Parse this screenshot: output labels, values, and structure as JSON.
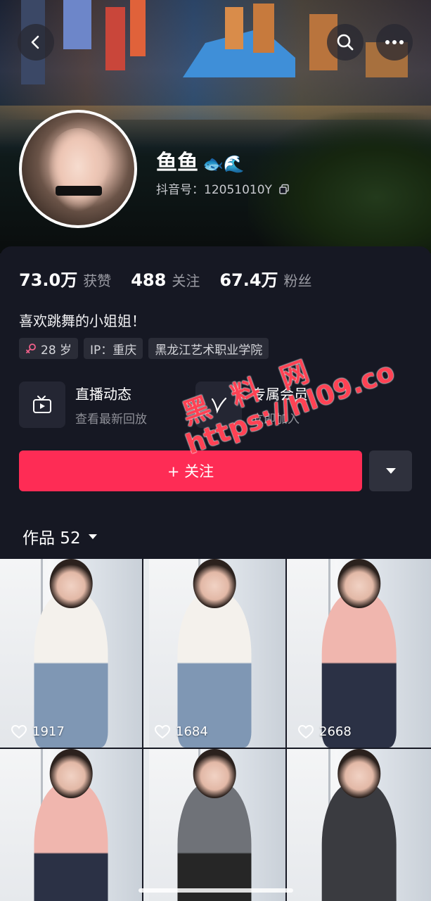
{
  "header": {
    "back_icon": "chevron-left-icon",
    "search_icon": "search-icon",
    "more_icon": "ellipsis-icon"
  },
  "profile": {
    "name": "鱼鱼",
    "name_emojis": "🐟🌊",
    "douyin_id": "抖音号：12051010Y",
    "copy_icon": "copy-icon"
  },
  "stats": [
    {
      "value": "73.0万",
      "label": "获赞"
    },
    {
      "value": "488",
      "label": "关注"
    },
    {
      "value": "67.4万",
      "label": "粉丝"
    }
  ],
  "bio": "喜欢跳舞的小姐姐！",
  "tags": [
    {
      "icon": "female-icon",
      "text": "28 岁"
    },
    {
      "text": "IP：重庆"
    },
    {
      "text": "黑龙江艺术职业学院"
    }
  ],
  "features": [
    {
      "icon": "tv-icon",
      "title": "直播动态",
      "subtitle": "查看最新回放"
    },
    {
      "icon": "heart-v-icon",
      "title": "专属会员",
      "subtitle": "立即加入"
    }
  ],
  "actions": {
    "follow_label": "+ 关注",
    "dropdown_icon": "caret-down-icon"
  },
  "works": {
    "label": "作品 52"
  },
  "videos": [
    {
      "likes": "1917",
      "top": "white",
      "bottom": "denim"
    },
    {
      "likes": "1684",
      "top": "white",
      "bottom": "denim"
    },
    {
      "likes": "2668",
      "top": "pink",
      "bottom": "navy"
    },
    {
      "likes": "",
      "top": "pink",
      "bottom": "navy"
    },
    {
      "likes": "",
      "top": "gray",
      "bottom": "black"
    },
    {
      "likes": "",
      "top": "charcoal",
      "bottom": "charcoal"
    }
  ],
  "watermark": {
    "line1": "黑 料 网",
    "line2": "https://hl09.co"
  },
  "colors": {
    "accent": "#fe2c55",
    "background": "#161823"
  }
}
